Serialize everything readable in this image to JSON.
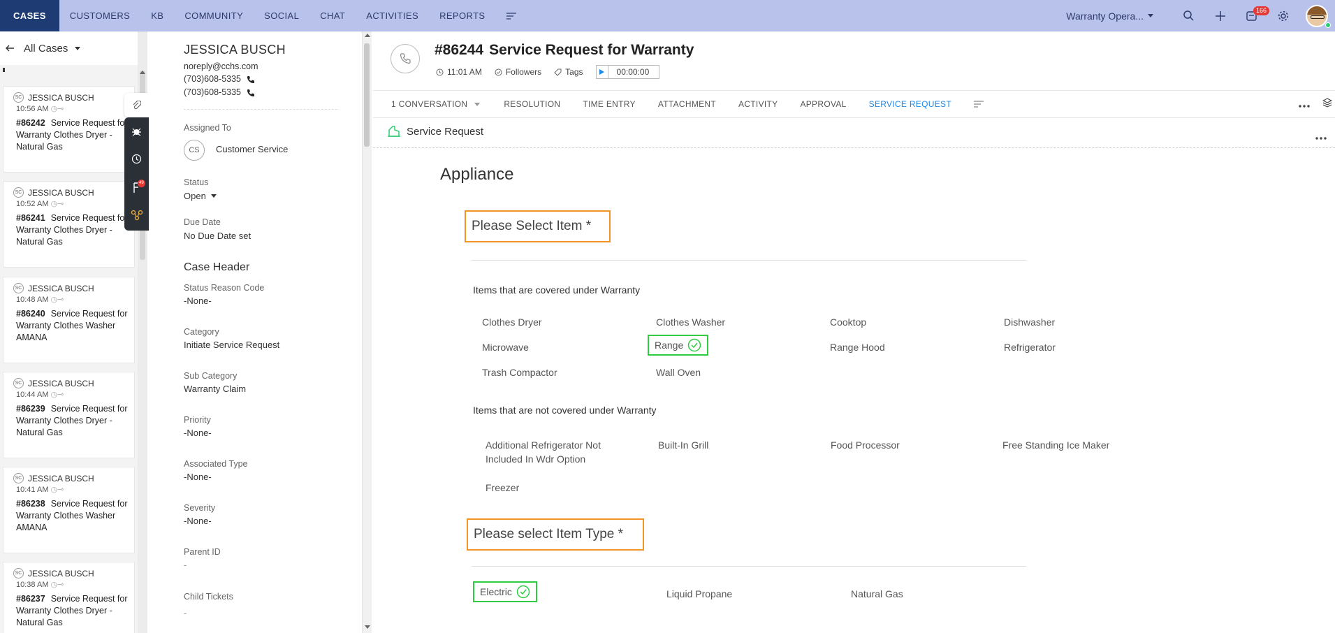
{
  "topbar": {
    "nav": [
      "CASES",
      "CUSTOMERS",
      "KB",
      "COMMUNITY",
      "SOCIAL",
      "CHAT",
      "ACTIVITIES",
      "REPORTS"
    ],
    "department": "Warranty Opera...",
    "notification_count": "166",
    "icons": [
      "more-menu-icon",
      "search-icon",
      "plus-icon",
      "notification-icon",
      "gear-icon"
    ]
  },
  "list": {
    "view_label": "All Cases",
    "cards": [
      {
        "name": "JESSICA BUSCH",
        "badge": "SC",
        "time": "10:56 AM",
        "id": "#86242",
        "subject": "Service Request for Warranty Clothes Dryer - Natural Gas"
      },
      {
        "name": "JESSICA BUSCH",
        "badge": "SC",
        "time": "10:52 AM",
        "id": "#86241",
        "subject": "Service Request for Warranty Clothes Dryer - Natural Gas"
      },
      {
        "name": "JESSICA BUSCH",
        "badge": "SC",
        "time": "10:48 AM",
        "id": "#86240",
        "subject": "Service Request for Warranty Clothes Washer AMANA"
      },
      {
        "name": "JESSICA BUSCH",
        "badge": "SC",
        "time": "10:44 AM",
        "id": "#86239",
        "subject": "Service Request for Warranty Clothes Dryer - Natural Gas"
      },
      {
        "name": "JESSICA BUSCH",
        "badge": "SC",
        "time": "10:41 AM",
        "id": "#86238",
        "subject": "Service Request for Warranty Clothes Washer AMANA"
      },
      {
        "name": "JESSICA BUSCH",
        "badge": "SC",
        "time": "10:38 AM",
        "id": "#86237",
        "subject": "Service Request for Warranty Clothes Dryer - Natural Gas"
      }
    ]
  },
  "floatbar": {
    "badge": "49"
  },
  "contact": {
    "name": "JESSICA BUSCH",
    "email": "noreply@cchs.com",
    "phone1": "(703)608-5335",
    "phone2": "(703)608-5335",
    "assigned_label": "Assigned To",
    "assigned_initials": "CS",
    "assigned_value": "Customer Service",
    "status_label": "Status",
    "status_value": "Open",
    "due_label": "Due Date",
    "due_value": "No Due Date set",
    "case_header": "Case Header",
    "reason_label": "Status Reason Code",
    "reason_value": "-None-",
    "category_label": "Category",
    "category_value": "Initiate Service Request",
    "subcategory_label": "Sub Category",
    "subcategory_value": "Warranty Claim",
    "priority_label": "Priority",
    "priority_value": "-None-",
    "assoc_label": "Associated Type",
    "assoc_value": "-None-",
    "severity_label": "Severity",
    "severity_value": "-None-",
    "parent_label": "Parent ID",
    "parent_value": "-",
    "child_label": "Child Tickets",
    "child_value": "-"
  },
  "ticket": {
    "id": "#86244",
    "title": "Service Request for Warranty",
    "time": "11:01 AM",
    "followers": "Followers",
    "tags": "Tags",
    "timer": "00:00:00"
  },
  "tabs": [
    {
      "label": "1  CONVERSATION",
      "dropdown": true
    },
    {
      "label": "RESOLUTION"
    },
    {
      "label": "TIME ENTRY"
    },
    {
      "label": "ATTACHMENT"
    },
    {
      "label": "ACTIVITY"
    },
    {
      "label": "APPROVAL"
    },
    {
      "label": "SERVICE REQUEST",
      "active": true
    }
  ],
  "form": {
    "section": "Service Request",
    "heading": "Appliance",
    "q1": "Please Select Item *",
    "covered_label": "Items that are covered under Warranty",
    "covered": [
      "Clothes Dryer",
      "Clothes Washer",
      "Cooktop",
      "Dishwasher",
      "Microwave",
      "Range",
      "Range Hood",
      "Refrigerator",
      "Trash Compactor",
      "Wall Oven"
    ],
    "covered_selected": "Range",
    "not_covered_label": "Items that are not covered under Warranty",
    "not_covered": [
      "Additional Refrigerator Not Included In Wdr Option",
      "Built-In Grill",
      "Food Processor",
      "Free Standing Ice Maker",
      "Freezer"
    ],
    "q2": "Please select Item Type *",
    "types": [
      "Electric",
      "Liquid Propane",
      "Natural Gas"
    ],
    "type_selected": "Electric"
  },
  "colors": {
    "nav_bg": "#b9c2ea",
    "nav_active": "#1f3b73",
    "highlight_orange": "#f39426",
    "selected_green": "#2ecc40",
    "tab_active": "#1e88e5"
  }
}
